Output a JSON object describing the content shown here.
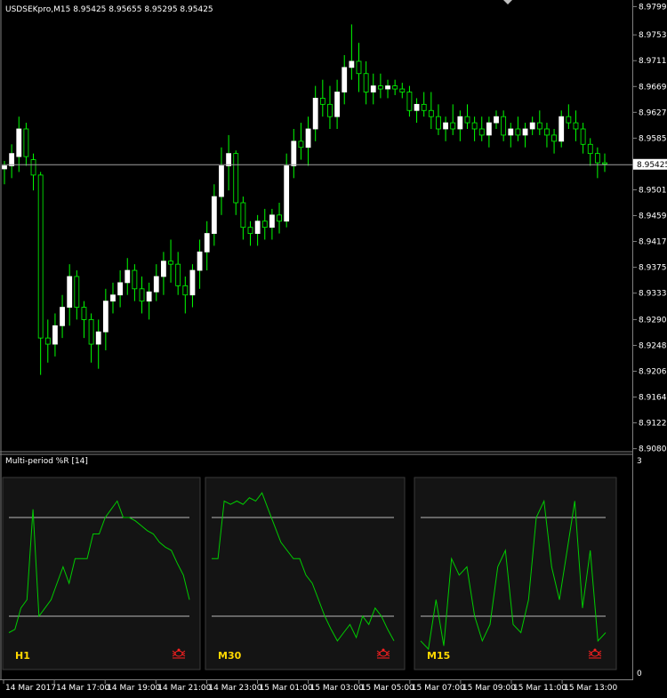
{
  "header": {
    "symbol_info": "USDSEKpro,M15  8.95425 8.95655 8.95295 8.95425"
  },
  "price_axis": {
    "labels": [
      "8.97990",
      "8.97530",
      "8.97110",
      "8.96690",
      "8.96270",
      "8.95850",
      "8.95010",
      "8.94590",
      "8.94170",
      "8.93750",
      "8.93330",
      "8.92900",
      "8.92480",
      "8.92060",
      "8.91640",
      "8.91220",
      "8.90800"
    ],
    "current_price": "8.95425",
    "current_value": 8.95425,
    "range": [
      8.9078,
      8.9801
    ]
  },
  "indicator": {
    "title": "Multi-period %R [14]",
    "scale_top": "3",
    "scale_bottom": "0",
    "panels": [
      {
        "label": "H1",
        "values": [
          -90,
          -88,
          -75,
          -70,
          -15,
          -80,
          -75,
          -70,
          -60,
          -50,
          -60,
          -45,
          -45,
          -45,
          -30,
          -30,
          -20,
          -15,
          -10,
          -20,
          -20,
          -22,
          -25,
          -28,
          -30,
          -35,
          -38,
          -40,
          -48,
          -55,
          -70
        ]
      },
      {
        "label": "M30",
        "values": [
          -45,
          -45,
          -10,
          -12,
          -10,
          -12,
          -8,
          -10,
          -5,
          -15,
          -25,
          -35,
          -40,
          -45,
          -45,
          -55,
          -60,
          -70,
          -80,
          -88,
          -95,
          -90,
          -85,
          -93,
          -80,
          -85,
          -75,
          -80,
          -88,
          -95
        ]
      },
      {
        "label": "M15",
        "values": [
          -95,
          -100,
          -70,
          -98,
          -45,
          -55,
          -50,
          -80,
          -95,
          -85,
          -50,
          -40,
          -85,
          -90,
          -70,
          -20,
          -10,
          -50,
          -70,
          -40,
          -10,
          -75,
          -40,
          -95,
          -90
        ]
      }
    ]
  },
  "time_axis": {
    "labels": [
      "14 Mar 2017",
      "14 Mar 17:00",
      "14 Mar 19:00",
      "14 Mar 21:00",
      "14 Mar 23:00",
      "15 Mar 01:00",
      "15 Mar 03:00",
      "15 Mar 05:00",
      "15 Mar 07:00",
      "15 Mar 09:00",
      "15 Mar 11:00",
      "15 Mar 13:00"
    ]
  },
  "candles": [
    [
      8.9535,
      8.9548,
      8.951,
      8.954
    ],
    [
      8.954,
      8.9575,
      8.952,
      8.956
    ],
    [
      8.9555,
      8.962,
      8.953,
      8.96
    ],
    [
      8.96,
      8.961,
      8.954,
      8.9555
    ],
    [
      8.955,
      8.956,
      8.95,
      8.9525
    ],
    [
      8.9525,
      8.953,
      8.92,
      8.926
    ],
    [
      8.926,
      8.929,
      8.922,
      8.925
    ],
    [
      8.925,
      8.93,
      8.923,
      8.928
    ],
    [
      8.928,
      8.933,
      8.926,
      8.931
    ],
    [
      8.931,
      8.938,
      8.928,
      8.936
    ],
    [
      8.936,
      8.937,
      8.929,
      8.931
    ],
    [
      8.931,
      8.932,
      8.926,
      8.929
    ],
    [
      8.929,
      8.93,
      8.922,
      8.925
    ],
    [
      8.925,
      8.929,
      8.921,
      8.927
    ],
    [
      8.927,
      8.934,
      8.924,
      8.932
    ],
    [
      8.932,
      8.935,
      8.93,
      8.933
    ],
    [
      8.933,
      8.937,
      8.931,
      8.935
    ],
    [
      8.935,
      8.939,
      8.933,
      8.937
    ],
    [
      8.937,
      8.938,
      8.932,
      8.934
    ],
    [
      8.934,
      8.936,
      8.93,
      8.932
    ],
    [
      8.932,
      8.935,
      8.929,
      8.9335
    ],
    [
      8.9335,
      8.938,
      8.932,
      8.936
    ],
    [
      8.936,
      8.94,
      8.933,
      8.9385
    ],
    [
      8.9385,
      8.942,
      8.935,
      8.938
    ],
    [
      8.938,
      8.94,
      8.933,
      8.9345
    ],
    [
      8.9345,
      8.936,
      8.93,
      8.933
    ],
    [
      8.933,
      8.938,
      8.931,
      8.937
    ],
    [
      8.937,
      8.942,
      8.934,
      8.94
    ],
    [
      8.94,
      8.945,
      8.937,
      8.943
    ],
    [
      8.943,
      8.951,
      8.941,
      8.949
    ],
    [
      8.949,
      8.957,
      8.946,
      8.954
    ],
    [
      8.954,
      8.959,
      8.95,
      8.956
    ],
    [
      8.956,
      8.9565,
      8.946,
      8.948
    ],
    [
      8.948,
      8.949,
      8.942,
      8.944
    ],
    [
      8.944,
      8.945,
      8.941,
      8.943
    ],
    [
      8.943,
      8.946,
      8.941,
      8.945
    ],
    [
      8.945,
      8.947,
      8.942,
      8.944
    ],
    [
      8.944,
      8.947,
      8.942,
      8.946
    ],
    [
      8.946,
      8.948,
      8.943,
      8.945
    ],
    [
      8.945,
      8.956,
      8.944,
      8.954
    ],
    [
      8.954,
      8.96,
      8.952,
      8.958
    ],
    [
      8.958,
      8.961,
      8.955,
      8.957
    ],
    [
      8.957,
      8.962,
      8.954,
      8.96
    ],
    [
      8.96,
      8.967,
      8.958,
      8.965
    ],
    [
      8.965,
      8.968,
      8.962,
      8.964
    ],
    [
      8.964,
      8.967,
      8.96,
      8.962
    ],
    [
      8.962,
      8.968,
      8.96,
      8.966
    ],
    [
      8.966,
      8.972,
      8.964,
      8.97
    ],
    [
      8.97,
      8.977,
      8.968,
      8.971
    ],
    [
      8.971,
      8.974,
      8.966,
      8.969
    ],
    [
      8.969,
      8.971,
      8.964,
      8.966
    ],
    [
      8.966,
      8.969,
      8.964,
      8.967
    ],
    [
      8.967,
      8.969,
      8.965,
      8.9665
    ],
    [
      8.9665,
      8.968,
      8.965,
      8.967
    ],
    [
      8.967,
      8.968,
      8.9655,
      8.9665
    ],
    [
      8.9665,
      8.9675,
      8.965,
      8.966
    ],
    [
      8.966,
      8.967,
      8.962,
      8.963
    ],
    [
      8.963,
      8.965,
      8.961,
      8.964
    ],
    [
      8.964,
      8.966,
      8.962,
      8.963
    ],
    [
      8.963,
      8.966,
      8.96,
      8.962
    ],
    [
      8.962,
      8.964,
      8.959,
      8.96
    ],
    [
      8.96,
      8.962,
      8.958,
      8.961
    ],
    [
      8.961,
      8.964,
      8.959,
      8.96
    ],
    [
      8.96,
      8.963,
      8.958,
      8.962
    ],
    [
      8.962,
      8.964,
      8.96,
      8.961
    ],
    [
      8.961,
      8.962,
      8.958,
      8.96
    ],
    [
      8.96,
      8.962,
      8.958,
      8.959
    ],
    [
      8.959,
      8.962,
      8.957,
      8.961
    ],
    [
      8.961,
      8.963,
      8.96,
      8.962
    ],
    [
      8.962,
      8.963,
      8.958,
      8.959
    ],
    [
      8.959,
      8.961,
      8.957,
      8.96
    ],
    [
      8.96,
      8.962,
      8.958,
      8.959
    ],
    [
      8.959,
      8.961,
      8.957,
      8.96
    ],
    [
      8.96,
      8.962,
      8.959,
      8.961
    ],
    [
      8.961,
      8.963,
      8.959,
      8.96
    ],
    [
      8.96,
      8.961,
      8.957,
      8.959
    ],
    [
      8.959,
      8.96,
      8.956,
      8.958
    ],
    [
      8.958,
      8.963,
      8.957,
      8.962
    ],
    [
      8.962,
      8.964,
      8.96,
      8.961
    ],
    [
      8.961,
      8.963,
      8.958,
      8.96
    ],
    [
      8.96,
      8.961,
      8.956,
      8.9575
    ],
    [
      8.9575,
      8.9585,
      8.954,
      8.956
    ],
    [
      8.956,
      8.957,
      8.952,
      8.9545
    ],
    [
      8.9545,
      8.956,
      8.953,
      8.9543
    ]
  ],
  "colors": {
    "background": "#000000",
    "candle_up": "#ffffff",
    "candle_down": "#000000",
    "candle_outline": "#00ff00",
    "indicator_line": "#00cc00",
    "panel_bg": "#141414",
    "panel_border": "#3a3a3a",
    "panel_label": "#ffd800",
    "bug_icon": "#ff2020",
    "grid_line": "#b8b8b8"
  }
}
